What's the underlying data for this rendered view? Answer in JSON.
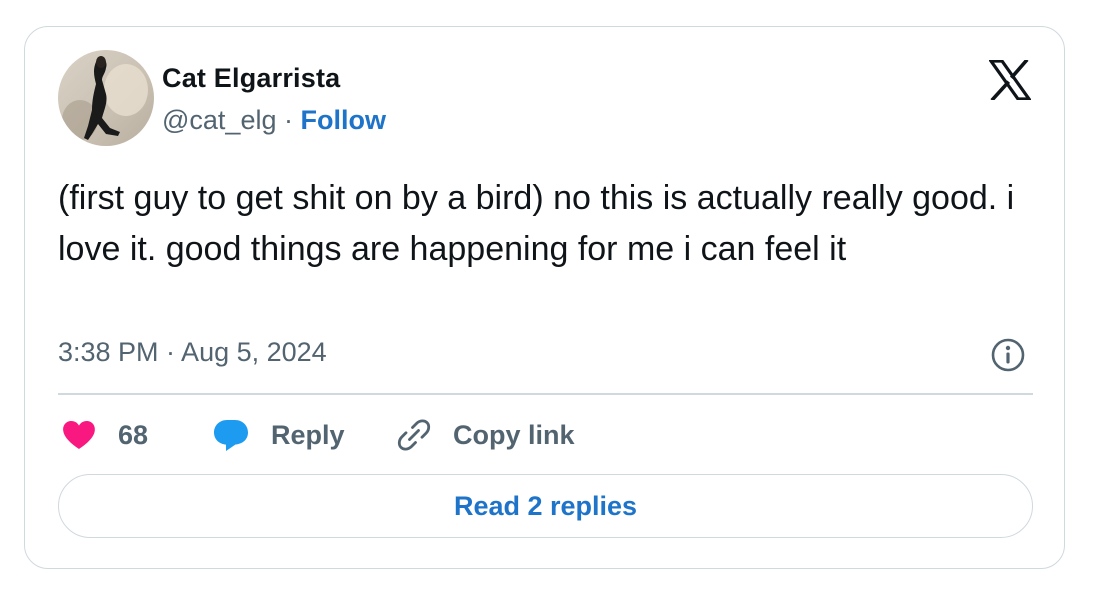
{
  "author": {
    "display_name": "Cat Elgarrista",
    "handle": "@cat_elg",
    "separator": " · ",
    "follow_label": "Follow",
    "avatar": "profile-photo"
  },
  "platform": {
    "logo_icon": "x-logo-icon"
  },
  "tweet": {
    "text": "(first guy to get shit on by a bird) no this is actually really good. i love it. good things are happening for me i can feel it",
    "timestamp": "3:38 PM · Aug 5, 2024"
  },
  "actions": {
    "likes_count": "68",
    "like_icon": "heart-icon",
    "reply_label": "Reply",
    "reply_icon": "speech-bubble-icon",
    "copy_link_label": "Copy link",
    "copy_link_icon": "link-icon"
  },
  "read_replies_label": "Read 2 replies",
  "info_icon": "info-icon",
  "colors": {
    "link_blue": "#1d74c9",
    "like_pink": "#f91880",
    "reply_blue": "#1d9bf0",
    "text_primary": "#0f1419",
    "text_secondary": "#536471",
    "border": "#cfd9de"
  }
}
